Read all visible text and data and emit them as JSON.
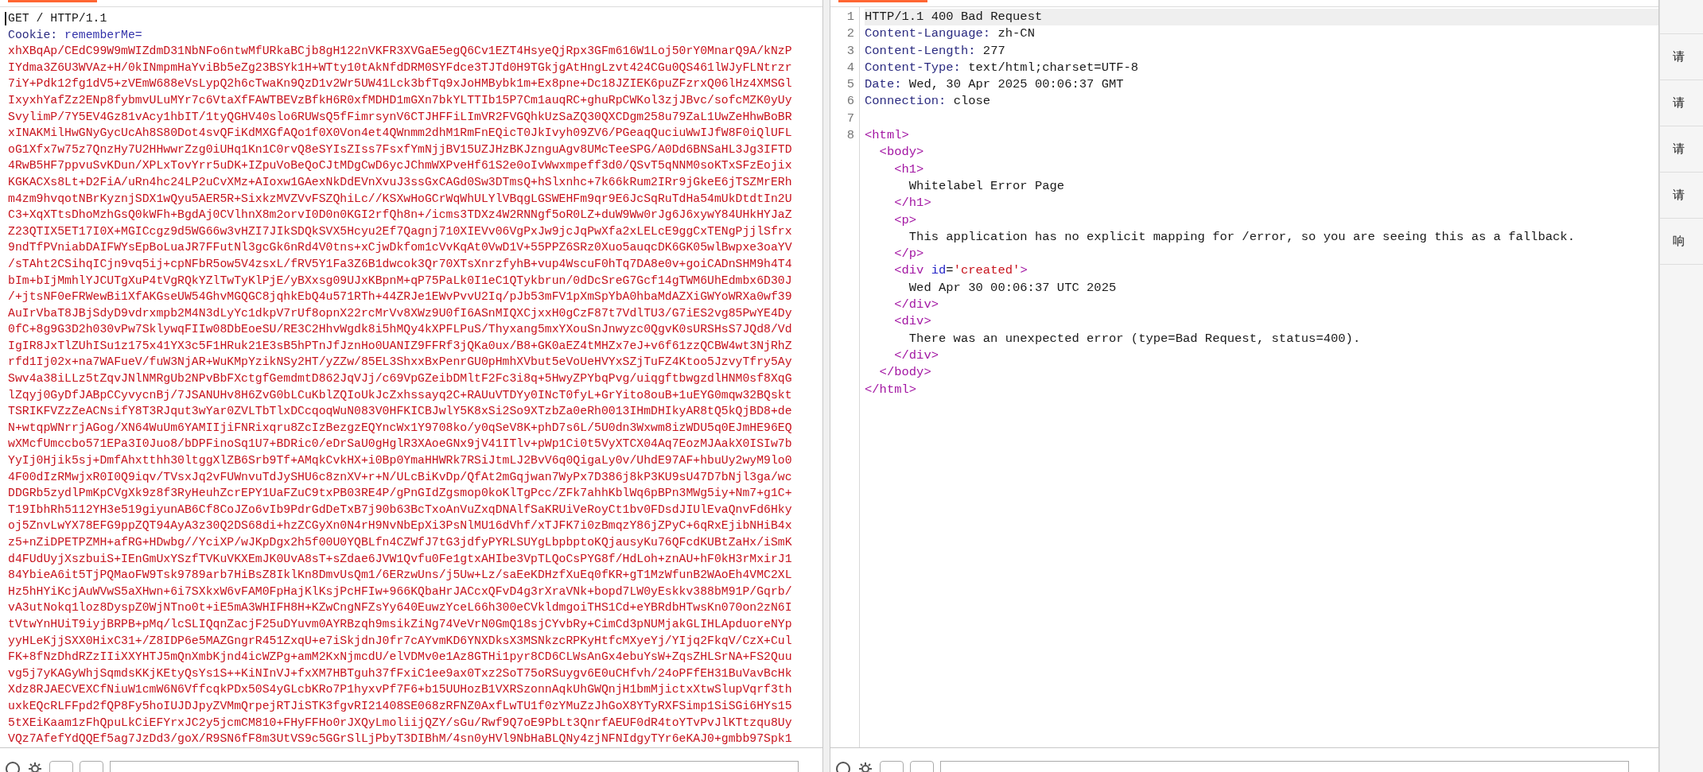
{
  "request": {
    "request_line": "GET / HTTP/1.1",
    "header": {
      "name": "Cookie:",
      "value": "rememberMe="
    },
    "cookie_value_lines": [
      "xhXBqAp/CEdC99W9mWIZdmD31NbNFo6ntwMfURkaBCjb8gH122nVKFR3XVGaE5egQ6Cv1EZT4HsyeQjRpx3GFm616W1Loj50rY0MnarQ9A/kNzP",
      "IYdma3Z6U3WVAz+H/0kINmpmHaYviBb5eZg23BSYk1H+WTty10tAkNfdDRM0SYFdce3TJTd0H9TGkjgAtHngLzvt424CGu0QS461lWJyFLNtrzr",
      "7iY+Pdk12fg1dV5+zVEmW688eVsLypQ2h6cTwaKn9QzD1v2Wr5UW41Lck3bfTq9xJoHMBybk1m+Ex8pne+Dc18JZIEK6puZFzrxQ06lHz4XMSGl",
      "IxyxhYafZz2ENp8fybmvULuMYr7c6VtaXfFAWTBEVzBfkH6R0xfMDHD1mGXn7bkYLTTIb15P7Cm1auqRC+ghuRpCWKol3zjJBvc/sofcMZK0yUy",
      "SvylimP/7Y5EV4Gz81vAcy1hbIT/1tyQGHV40slo6RUWsQ5fFimrsynV6CTJHFFiLImVR2FVGQhkUzSaZQ30QXCDgm258u79ZaL1UwZeHhwBoBR",
      "xINAKMilHwGNyGycUcAh8S80Dot4svQFiKdMXGfAQo1f0X0Von4et4QWnmm2dhM1RmFnEQicT0JkIvyh09ZV6/PGeaqQuciuWwIJfW8F0iQlUFL",
      "oG1Xfx7w75z7QnzHy7U2HHwwrZzg0iUHq1Kn1C0rvQ8eSYIsZIss7FsxfYmNjjBV15UZJHzBKJznguAgv8UMcTeeSPG/A0Dd6BNSaHL3Jg3IFTD",
      "4RwB5HF7ppvuSvKDun/XPLxTovYrr5uDK+IZpuVoBeQoCJtMDgCwD6ycJChmWXPveHf61S2e0oIvWwxmpeff3d0/QSvT5qNNM0soKTxSFzEojix",
      "KGKACXs8Lt+D2FiA/uRn4hc24LP2uCvXMz+AIoxw1GAexNkDdEVnXvuJ3ssGxCAGd0Sw3DTmsQ+hSlxnhc+7k66kRum2IRr9jGkeE6jTSZMrERh",
      "m4zm9hvqotNBrKyznjSDX1wQyu5AER5R+SixkzMVZVvFSZQhiLc//KSXwHoGCrWqWhULYlVBqgLGSWEHFm9qr9E6JcSqRuTdHa54mUkDtdtIn2U",
      "C3+XqXTtsDhoMzhGsQ0kWFh+BgdAj0CVlhnX8m2orvI0D0n0KGI2rfQh8n+/icms3TDXz4W2RNNgf5oR0LZ+duW9Ww0rJg6J6xywY84UHkHYJaZ",
      "Z23QTIX5ET17I0X+MGICcgz9d5WG66w3vHZI7JIkSDQkSVX5Hcyu2Ef7Qagnj710XIEVv06VgPxJw9jcJqPwXfa2xLELcE9ggCxTENgPjjlSfrx",
      "9ndTfPVniabDAIFWYsEpBoLuaJR7FFutNl3gcGk6nRd4V0tns+xCjwDkfom1cVvKqAt0VwD1V+55PPZ6SRz0Xuo5auqcDK6GK05wlBwpxe3oaYV",
      "/sTAht2CSihqICjn9vq5ij+cpNFbR5ow5V4zsxL/fRV5Y1Fa3Z6B1dwcok3Qr70XTsXnrzfyhB+vup4WscuF0hTq7DA8e0v+goiCADnSHM9h4T4",
      "bIm+bIjMmhlYJCUTgXuP4tVgRQkYZlTwTyKlPjE/yBXxsg09UJxKBpnM+qP75PaLk0I1eC1QTykbrun/0dDcSreG7Gcf14gTWM6UhEdmbx6D30J",
      "/+jtsNF0eFRWewBi1XfAKGseUW54GhvMGQGC8jqhkEbQ4u571RTh+44ZRJe1EWvPvvU2Iq/pJb53mFV1pXmSpYbA0hbaMdAZXiGWYoWRXa0wf39",
      "AuIrVbaT8JBjSdyD9vdrxmpb2M4N3dLyYc1dkpV7rUf8opnX22rcMrVv8XWz9U0fI6ASnMIQXCjxxH0gCzF87t7VdlTU3/G7iES2vg85PwYE4Dy",
      "0fC+8g9G3D2h030vPw7SklywqFIIw08DbEoeSU/RE3C2HhvWgdk8i5hMQy4kXPFLPuS/Thyxang5mxYXouSnJnwyzc0QgvK0sURSHsS7JQd8/Vd",
      "IgIR8JxTlZUhISu1z175x41YX3c5F1HRuk21E3sB5hPTnJfJznHo0UANIZ9FFRf3jQKa0ux/B8+GK0aEZ4tMHZx7eJ+v6f61zzQCBW4wt3NjRhZ",
      "rfd1Ij02x+na7WAFueV/fuW3NjAR+WuKMpYzikNSy2HT/yZZw/85EL3ShxxBxPenrGU0pHmhXVbut5eVoUeHVYxSZjTuFZ4Ktoo5JzvyTfry5Ay",
      "Swv4a38iLLz5tZqvJNlNMRgUb2NPvBbFXctgfGemdmtD862JqVJj/c69VpGZeibDMltF2Fc3i8q+5HwyZPYbqPvg/uiqgftbwgzdlHNM0sf8XqG",
      "lZqyj0GyDfJABpCCyvycnBj/7JSANUHv8H6ZvG0bLCuKblZQIoUkJcZxhssayq2C+RAUuVTDYy0INcT0fyL+GrYito8ouB+1uEYG0mqw32BQskt",
      "TSRIKFVZzZeACNsifY8T3RJqut3wYar0ZVLTbTlxDCcqoqWuN083V0HFKICBJwlY5K8xSi2So9XTzbZa0eRh0013IHmDHIkyAR8tQ5kQjBD8+de",
      "N+wtqpWNrrjAGog/XN64WuUm6YAMIIjiFNRixqru8ZcIzBezgzEQYncWx1Y9708ko/y0qSeV8K+phD7s6L/5U0dn3Wxwm8izWDU5q0EJmHE96EQ",
      "wXMcfUmccbo571EPa3I0Juo8/bDPFinoSq1U7+BDRic0/eDrSaU0gHglR3XAoeGNx9jV41ITlv+pWp1Ci0t5VyXTCX04Aq7EozMJAakX0ISIw7b",
      "YyIj0Hjik5sj+DmfAhxtthh30ltggXlZB6Srb9Tf+AMqkCvkHX+i0Bp0YmaHHWRk7RSiJtmLJ2BvV6q0QigaLy0v/UhdE97AF+hbuUy2wyM9lo0",
      "4F00dIzRMwjxR0I0Q9iqv/TVsxJq2vFUWnvuTdJySHU6c8znXV+r+N/ULcBiKvDp/QfAt2mGqjwan7WyPx7D386j8kP3KU9sU47D7bNjl3ga/wc",
      "DDGRb5zydlPmKpCVgXk9z8f3RyHeuhZcrEPY1UaFZuC9txPB03RE4P/gPnGIdZgsmop0koKlTgPcc/ZFk7ahhKblWq6pBPn3MWg5iy+Nm7+g1C+",
      "T19IbhRh5112YH3e519giyunAB6Cf8CoJZo6vIb9PdrGdDeTxB7j90b63BcTxoAnVuZxqDNAlfSaKRUiVeRoyCt1bv0FDsdJIUlEvaQnvFd6Hky",
      "oj5ZnvLwYX78EFG9ppZQT94AyA3z30Q2DS68di+hzZCGyXn0N4rH9NvNbEpXi3PsNlMU16dVhf/xTJFK7i0zBmqzY86jZPyC+6qRxEjibNHiB4x",
      "z5+nZiDPETPZMH+afRG+HDwbg//YciXP/wJKpDgx2h5f00U0YQBLfn4CZWfJ7tG3jdfyPYRLSUYgLbpbptoKQjausyKu76QFcdKUBtZaHx/iSmK",
      "d4FUdUyjXszbuiS+IEnGmUxYSzfTVKuVKXEmJK0UvA8sT+sZdae6JVW1Qvfu0Fe1gtxAHIbe3VpTLQoCsPYG8f/HdLoh+znAU+hF0kH3rMxirJ1",
      "84YbieA6it5TjPQMaoFW9Tsk9789arb7HiBsZ8IklKn8DmvUsQm1/6ERzwUns/j5Uw+Lz/saEeKDHzfXuEq0fKR+gT1MzWfunB2WAoEh4VMC2XL",
      "Hz5hHYiKcjAuWVwS5aXHwn+6i7SXkxW6vFAM0FpHajKlKsjPcHFIw+966KQbaHrJACcxQFvD4g3rXraVNk+bopd7LW0yEskkv388bM91P/Gqrb/",
      "vA3utNokq1loz8DyspZ0WjNTno0t+iE5mA3WHIFH8H+KZwCngNFZsYy640EuwzYceL66h300eCVkldmgoiTHS1Cd+eYBRdbHTwsKn070on2zN6I",
      "tVtwYnHUiT9iyjBRPB+pMq/lcSLIQqnZacjF25uDYuvm0AYRBzqh9msikZiNg74VeVrN0GmQ18sjCYvbRy+CimCd3pNUMjakGLIHLApduoreNYp",
      "yyHLeKjjSXX0HixC31+/Z8IDP6e5MAZGngrR451ZxqU+e7iSkjdnJ0fr7cAYvmKD6YNXDksX3MSNkzcRPKyHtfcMXyeYj/YIjq2FkqV/CzX+Cul",
      "FK+8fNzDhdRZzIIiXXYHTJ5mQnXmbKjnd4icWZPg+amM2KxNjmcdU/elVDMv0e1Az8GTHi1pyr8CD6CLWsAnGx4ebuYsW+ZqsZHLSrNA+FS2Quu",
      "vg5j7yKAGyWhjSqmdsKKjKEtyQsYs1S++KiNInVJ+fxXM7HBTguh37fFxiC1ee9ax0Txz2SoT75oRSuygv6E0uCHfvh/24oPFfEH31BuVavBcHk",
      "Xdz8RJAECVEXCfNiuW1cmW6N6VffcqkPDx50S4yGLcbKRo7P1hyxvPf7F6+b15UUHozB1VXRSzonnAqkUhGWQnjH1bmMjictxXtwSlupVqrf3th",
      "uxkEQcRLFFpd2fQP8Fy5hoIUJDJpyZVMmQrpejRTJiSTK3fgvRI21408SE068zRFNZ0AxfLwTU1f0zYMuZzJhGoX8YTyRXFSimp1SiSGi6HYs15",
      "5tXEiKaam1zFhQpuLkCiEFYrxJC2y5jcmCM810+FHyFFHo0rJXQyLmoliijQZY/sGu/Rwf9Q7oE9PbLt3QnrfAEUF0dR4toYTvPvJlKTtzqu8Uy",
      "VQz7AfefYdQQEf5ag7JzDd3/goX/R9SN6fF8m3UtVS9c5GGrSlLjPbyT3DIBhM/4sn0yHVl9NbHaBLQNy4zjNFNIdgyTYr6eKAJ0+gmbb97Spk1"
    ]
  },
  "response": {
    "lines": [
      {
        "number": "1",
        "kind": "status",
        "text": "HTTP/1.1 400 Bad Request"
      },
      {
        "number": "2",
        "kind": "header",
        "name": "Content-Language:",
        "value": "zh-CN"
      },
      {
        "number": "3",
        "kind": "header",
        "name": "Content-Length:",
        "value": "277"
      },
      {
        "number": "4",
        "kind": "header",
        "name": "Content-Type:",
        "value": "text/html;charset=UTF-8"
      },
      {
        "number": "5",
        "kind": "header",
        "name": "Date:",
        "value": "Wed, 30 Apr 2025 00:06:37 GMT"
      },
      {
        "number": "6",
        "kind": "header",
        "name": "Connection:",
        "value": "close"
      },
      {
        "number": "7",
        "kind": "blank"
      }
    ],
    "body_number": "8",
    "body": [
      {
        "kind": "element",
        "open": [
          {
            "kind": "tag",
            "text": "<html>"
          }
        ],
        "close": "</html>",
        "children": [
          {
            "kind": "element",
            "open": [
              {
                "kind": "tag",
                "text": "<body>"
              }
            ],
            "close": "</body>",
            "children": [
              {
                "kind": "element",
                "open": [
                  {
                    "kind": "tag",
                    "text": "<h1>"
                  }
                ],
                "close": "</h1>",
                "children": [
                  {
                    "kind": "text",
                    "text": "Whitelabel Error Page"
                  }
                ]
              },
              {
                "kind": "element",
                "open": [
                  {
                    "kind": "tag",
                    "text": "<p>"
                  }
                ],
                "close": "</p>",
                "children": [
                  {
                    "kind": "text",
                    "text": "This application has no explicit mapping for /error, so you are seeing this as a fallback."
                  }
                ]
              },
              {
                "kind": "element",
                "open": [
                  {
                    "kind": "tag",
                    "text": "<div"
                  },
                  {
                    "kind": "attr",
                    "text": "id"
                  },
                  {
                    "kind": "punct",
                    "text": "="
                  },
                  {
                    "kind": "value",
                    "text": "'created'"
                  },
                  {
                    "kind": "tag",
                    "text": ">"
                  }
                ],
                "close": "</div>",
                "children": [
                  {
                    "kind": "text",
                    "text": "Wed Apr 30 00:06:37 UTC 2025"
                  }
                ]
              },
              {
                "kind": "element",
                "open": [
                  {
                    "kind": "tag",
                    "text": "<div>"
                  }
                ],
                "close": "</div>",
                "children": [
                  {
                    "kind": "text",
                    "text": "There was an unexpected error (type=Bad Request, status=400)."
                  }
                ]
              }
            ]
          }
        ]
      }
    ]
  },
  "side_tabs": [
    "请",
    "请",
    "请",
    "请",
    "响"
  ]
}
